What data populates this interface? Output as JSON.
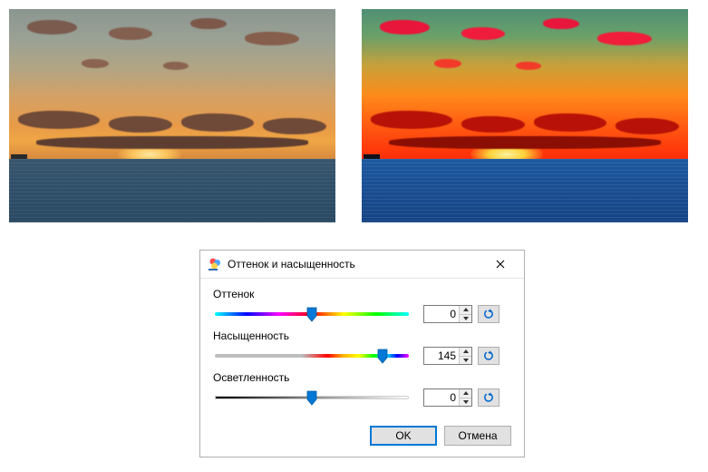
{
  "dialog": {
    "title": "Оттенок и насыщенность",
    "close_tooltip": "Закрыть",
    "sliders": {
      "hue": {
        "label": "Оттенок",
        "value": 0,
        "min": -180,
        "max": 180
      },
      "saturation": {
        "label": "Насыщенность",
        "value": 145,
        "min": -200,
        "max": 200
      },
      "lightness": {
        "label": "Осветленность",
        "value": 0,
        "min": -100,
        "max": 100
      }
    },
    "buttons": {
      "ok": "OK",
      "cancel": "Отмена",
      "reset_tooltip": "Сброс"
    }
  },
  "images": {
    "left_alt": "Исходное изображение заката над морем",
    "right_alt": "Изображение с увеличенной насыщенностью"
  }
}
